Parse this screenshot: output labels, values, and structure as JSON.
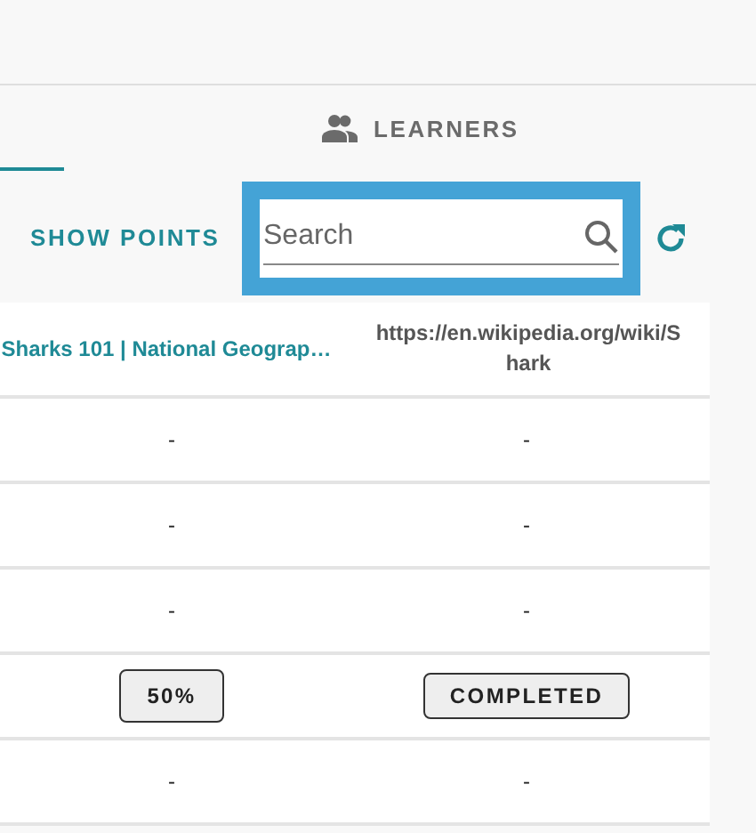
{
  "tabs": [
    {
      "selected": true
    },
    {
      "label": "LEARNERS",
      "selected": false
    }
  ],
  "toolbar": {
    "show_points": "SHOW POINTS",
    "search": {
      "placeholder": "Search",
      "focused": true
    }
  },
  "table": {
    "columns": [
      {
        "label": "Sharks 101 | National Geograp…",
        "kind": "link"
      },
      {
        "label": "https://en.wikipedia.org/wiki/Shark",
        "kind": "text"
      }
    ],
    "rows": [
      [
        {
          "kind": "text",
          "value": "-"
        },
        {
          "kind": "text",
          "value": "-"
        }
      ],
      [
        {
          "kind": "text",
          "value": "-"
        },
        {
          "kind": "text",
          "value": "-"
        }
      ],
      [
        {
          "kind": "text",
          "value": "-"
        },
        {
          "kind": "text",
          "value": "-"
        }
      ],
      [
        {
          "kind": "badge",
          "value": "50%"
        },
        {
          "kind": "badge",
          "value": "COMPLETED"
        }
      ],
      [
        {
          "kind": "text",
          "value": "-"
        },
        {
          "kind": "text",
          "value": "-"
        }
      ]
    ]
  }
}
